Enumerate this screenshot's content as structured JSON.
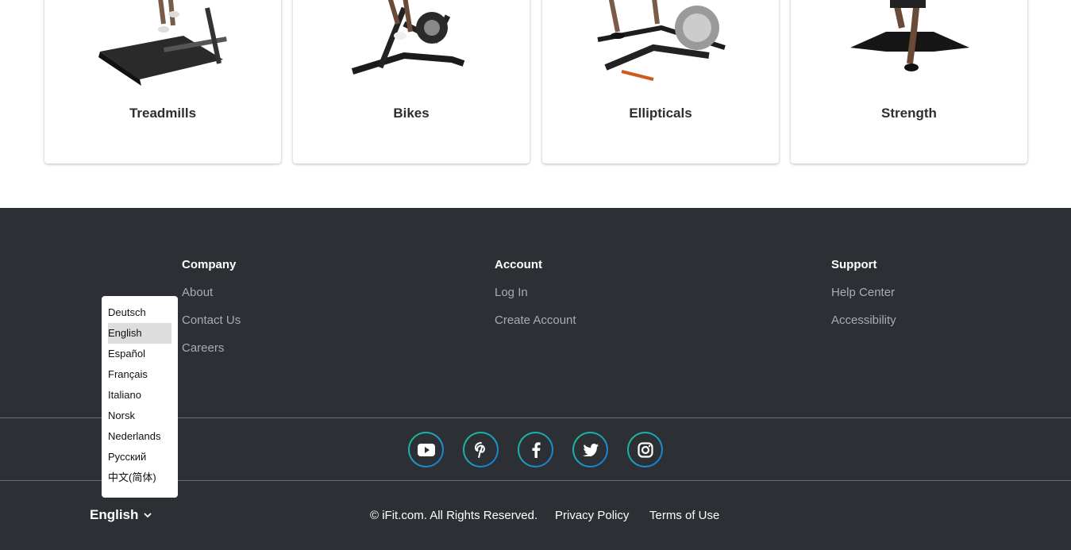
{
  "categories": [
    {
      "label": "Treadmills",
      "icon": "treadmill-image"
    },
    {
      "label": "Bikes",
      "icon": "bike-image"
    },
    {
      "label": "Ellipticals",
      "icon": "elliptical-image"
    },
    {
      "label": "Strength",
      "icon": "strength-image"
    }
  ],
  "footer": {
    "company": {
      "heading": "Company",
      "links": [
        "About",
        "Contact Us",
        "Careers"
      ]
    },
    "account": {
      "heading": "Account",
      "links": [
        "Log In",
        "Create Account"
      ]
    },
    "support": {
      "heading": "Support",
      "links": [
        "Help Center",
        "Accessibility"
      ]
    },
    "social": [
      "youtube-icon",
      "pinterest-icon",
      "facebook-icon",
      "twitter-icon",
      "instagram-icon"
    ],
    "copyright": "© iFit.com. All Rights Reserved.",
    "privacy": "Privacy Policy",
    "terms": "Terms of Use"
  },
  "language": {
    "current": "English",
    "options": [
      "Deutsch",
      "English",
      "Español",
      "Français",
      "Italiano",
      "Norsk",
      "Nederlands",
      "Русский",
      "中文(简体)"
    ],
    "selected_index": 1
  },
  "colors": {
    "footer_bg": "#2c2f33",
    "link": "#a9acb1",
    "accent_start": "#1fc28e",
    "accent_end": "#1a6fe0"
  }
}
